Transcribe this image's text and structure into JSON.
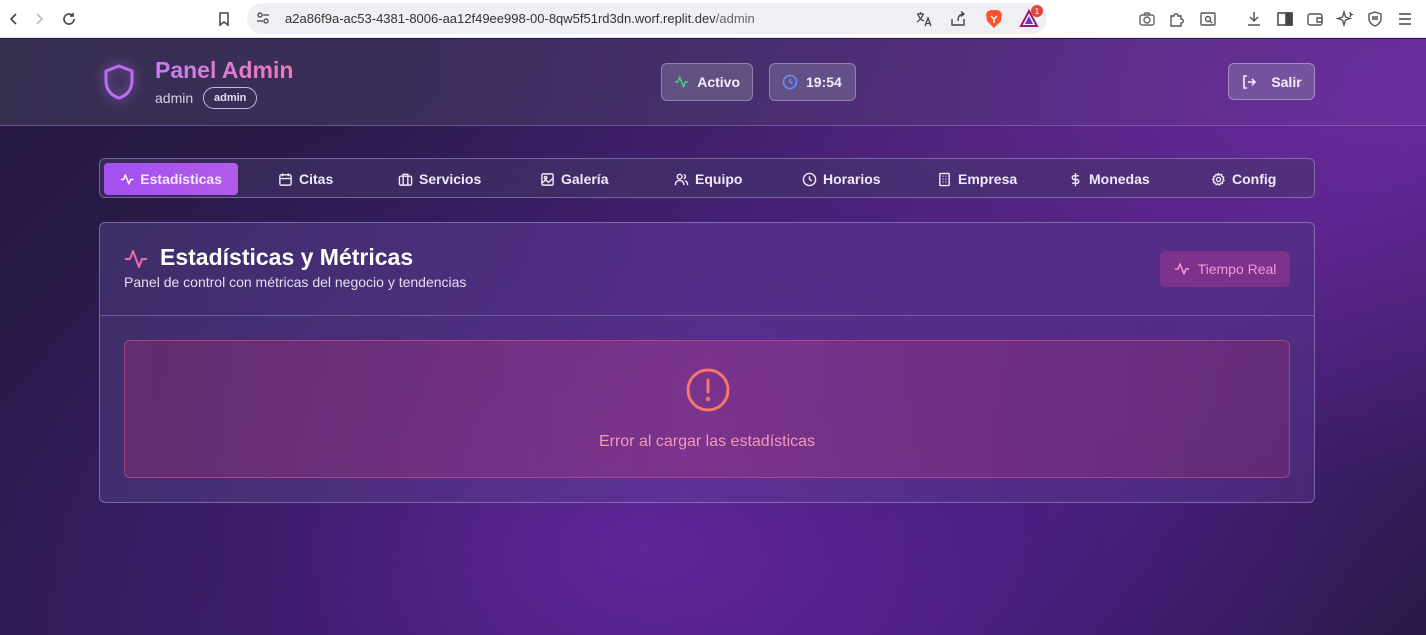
{
  "browser": {
    "url_host": "a2a86f9a-ac53-4381-8006-aa12f49ee998-00-8qw5f51rd3dn.worf.replit.dev",
    "url_path": "/admin",
    "rewards_count": "1",
    "icons": [
      "back-icon",
      "forward-icon",
      "reload-icon",
      "bookmark-icon",
      "site-settings-icon",
      "translate-icon",
      "share-icon",
      "brave-shields-icon",
      "brave-rewards-icon",
      "screenshot-icon",
      "extensions-icon",
      "reader-icon",
      "download-icon",
      "sidebar-icon",
      "wallet-icon",
      "leo-ai-icon",
      "vpn-icon",
      "menu-icon"
    ]
  },
  "header": {
    "title": "Panel Admin",
    "username": "admin",
    "role": "admin",
    "status_label": "Activo",
    "time": "19:54",
    "logout_label": "Salir"
  },
  "tabs": [
    {
      "label": "Estadísticas",
      "icon": "activity-icon",
      "active": true
    },
    {
      "label": "Citas",
      "icon": "calendar-icon",
      "active": false
    },
    {
      "label": "Servicios",
      "icon": "briefcase-icon",
      "active": false
    },
    {
      "label": "Galería",
      "icon": "image-icon",
      "active": false
    },
    {
      "label": "Equipo",
      "icon": "users-icon",
      "active": false
    },
    {
      "label": "Horarios",
      "icon": "clock-icon",
      "active": false
    },
    {
      "label": "Empresa",
      "icon": "building-icon",
      "active": false
    },
    {
      "label": "Monedas",
      "icon": "dollar-icon",
      "active": false
    },
    {
      "label": "Config",
      "icon": "settings-icon",
      "active": false
    }
  ],
  "stats_card": {
    "title": "Estadísticas y Métricas",
    "subtitle": "Panel de control con métricas del negocio y tendencias",
    "realtime_label": "Tiempo Real",
    "error_message": "Error al cargar las estadísticas"
  },
  "colors": {
    "accent_pink": "#e07ad0",
    "active_tab": "#a24ff0",
    "status_green": "#3fd68a",
    "clock_blue": "#6b8cff",
    "error_coral": "#f2766a"
  }
}
